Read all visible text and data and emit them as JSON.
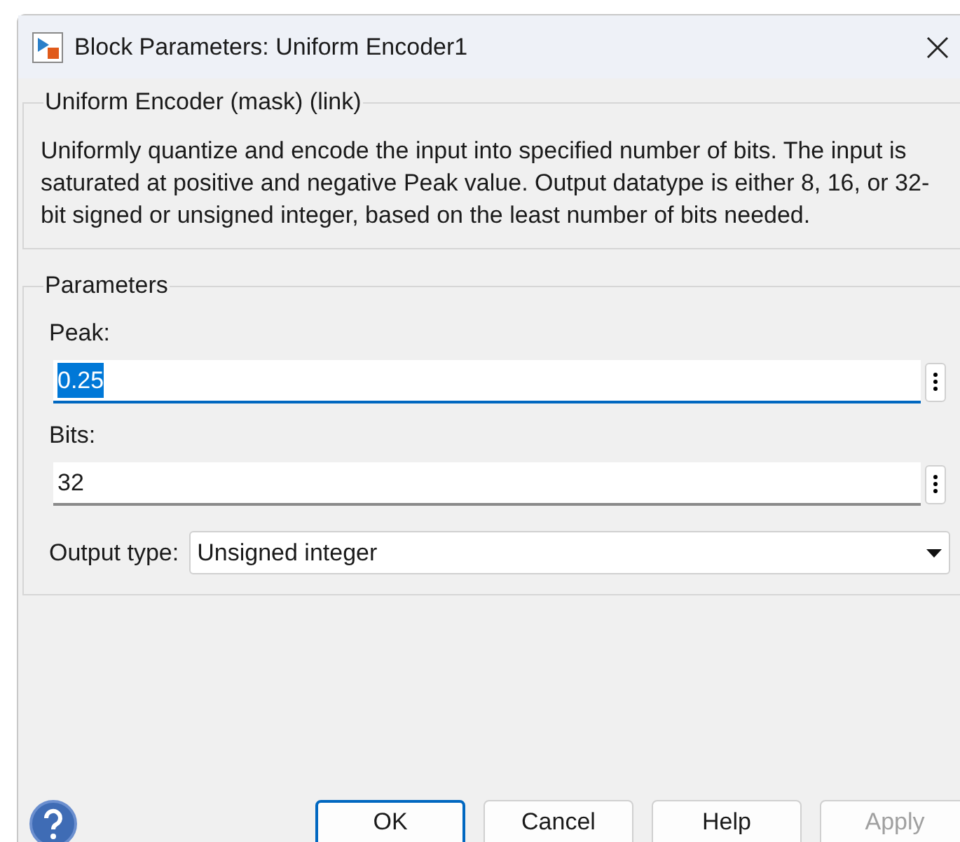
{
  "window": {
    "title": "Block Parameters: Uniform Encoder1"
  },
  "description_group": {
    "title": "Uniform Encoder (mask) (link)",
    "text": "Uniformly quantize and encode the input into specified number of bits. The input is saturated at positive and negative Peak value. Output datatype is either 8, 16, or 32-bit signed or unsigned integer, based on the least number of bits needed."
  },
  "parameters": {
    "title": "Parameters",
    "fields": [
      {
        "kind": "text",
        "label": "Peak:",
        "value": "0.25",
        "focused": true,
        "selected_text": true
      },
      {
        "kind": "text",
        "label": "Bits:",
        "value": "32",
        "focused": false,
        "selected_text": false
      },
      {
        "kind": "select",
        "label": "Output type:",
        "value": "Unsigned integer"
      }
    ]
  },
  "buttons": [
    {
      "label": "OK",
      "default": true,
      "disabled": false
    },
    {
      "label": "Cancel",
      "default": false,
      "disabled": false
    },
    {
      "label": "Help",
      "default": false,
      "disabled": false
    },
    {
      "label": "Apply",
      "default": false,
      "disabled": true
    }
  ]
}
